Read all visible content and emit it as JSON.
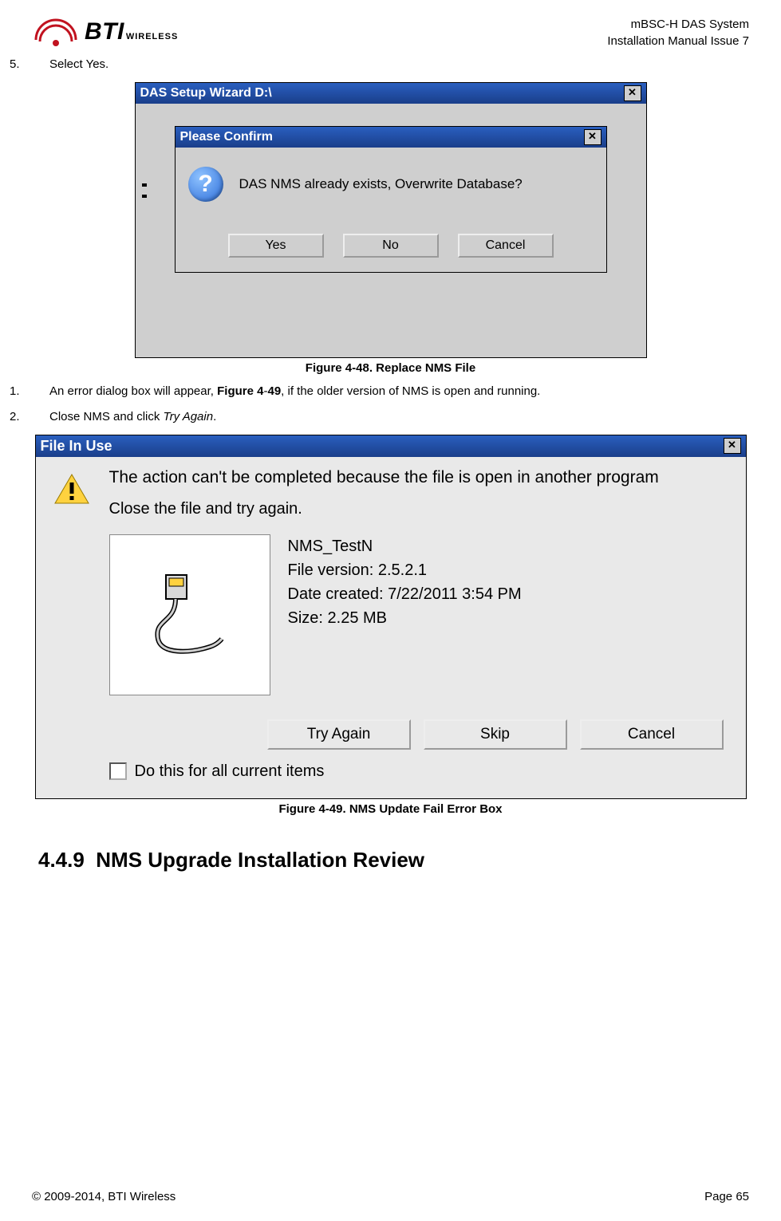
{
  "header": {
    "logo_main": "BTI",
    "logo_sub": "WIRELESS",
    "line1": "mBSC-H DAS System",
    "line2": "Installation Manual Issue 7"
  },
  "step5": {
    "num": "5.",
    "text": "Select Yes."
  },
  "fig48": {
    "outer_title": "DAS Setup Wizard D:\\",
    "inner_title": "Please Confirm",
    "message": "DAS NMS already exists, Overwrite Database?",
    "btn_yes": "Yes",
    "btn_no": "No",
    "btn_cancel": "Cancel",
    "caption": "Figure 4-48. Replace NMS File"
  },
  "step1": {
    "num": "1.",
    "text_a": "An error dialog box will appear, ",
    "bold_ref": "Figure 4",
    "dash": "-",
    "bold_ref2": "49",
    "text_b": ", if the older version of NMS is open and running."
  },
  "step2": {
    "num": "2.",
    "text_a": "Close NMS and click ",
    "italic": "Try Again",
    "text_b": "."
  },
  "fig49": {
    "title": "File In Use",
    "line1": "The action can't be completed because the file is open in another program",
    "line2": "Close the file and try again.",
    "meta_name": "NMS_TestN",
    "meta_ver": "File version: 2.5.2.1",
    "meta_date": "Date created: 7/22/2011 3:54 PM",
    "meta_size": "Size: 2.25 MB",
    "btn_try": "Try Again",
    "btn_skip": "Skip",
    "btn_cancel": "Cancel",
    "checkbox_label": "Do this for all current items",
    "caption": "Figure 4-49. NMS Update Fail Error Box"
  },
  "section": {
    "num": "4.4.9",
    "title": "NMS Upgrade Installation Review"
  },
  "footer": {
    "copyright": "© 2009-2014, BTI Wireless",
    "page_label": "Page",
    "page_num": "65"
  }
}
